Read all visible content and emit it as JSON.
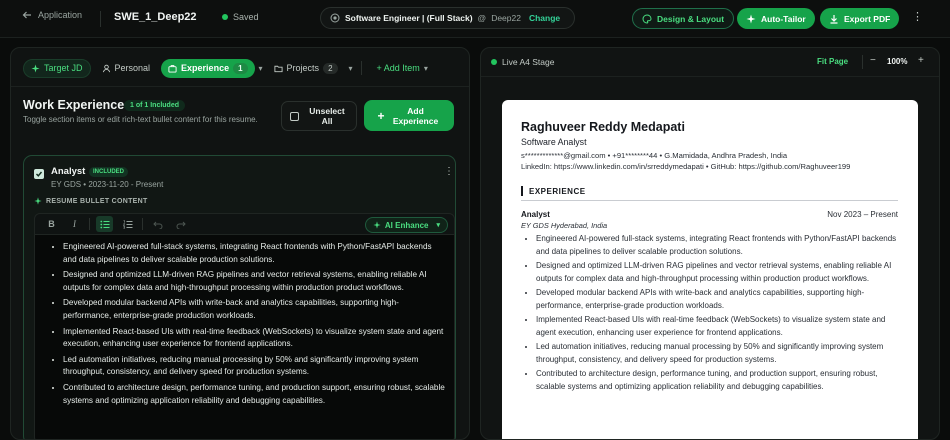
{
  "topbar": {
    "back_label": "Application",
    "doc_title": "SWE_1_Deep22",
    "save_status": "Saved",
    "job_role": "Software Engineer | (Full Stack)",
    "job_at": "@",
    "job_company": "Deep22",
    "change_label": "Change",
    "design_label": "Design & Layout",
    "autotailor_label": "Auto-Tailor",
    "export_label": "Export PDF",
    "more_label": "⋮"
  },
  "editor": {
    "tabs": {
      "target": "Target JD",
      "personal": "Personal",
      "experience": "Experience",
      "experience_count": "1",
      "projects": "Projects",
      "projects_count": "2",
      "add_item": "+ Add Item"
    },
    "section_title": "Work Experience",
    "included_badge": "1 of 1 Included",
    "section_desc": "Toggle section items or edit rich-text bullet content for this resume.",
    "unselect_label": "Unselect All",
    "add_experience_label": "Add Experience",
    "card": {
      "role": "Analyst",
      "included": "INCLUDED",
      "meta": "EY GDS • 2023-11-20 - Present",
      "bullet_content_label": "RESUME BULLET CONTENT",
      "toolbar": {
        "bold": "B",
        "italic": "I",
        "ai_enhance": "AI Enhance"
      },
      "bullets": [
        "Engineered AI-powered full-stack systems, integrating React frontends with Python/FastAPI backends and data pipelines to deliver scalable production solutions.",
        "Designed and optimized LLM-driven RAG pipelines and vector retrieval systems, enabling reliable AI outputs for complex data and high-throughput processing within production product workflows.",
        "Developed modular backend APIs with write-back and analytics capabilities, supporting high-performance, enterprise-grade production workloads.",
        "Implemented React-based UIs with real-time feedback (WebSockets) to visualize system state and agent execution, enhancing user experience for frontend applications.",
        "Led automation initiatives, reducing manual processing by 50% and significantly improving system throughput, consistency, and delivery speed for production systems.",
        "Contributed to architecture design, performance tuning, and production support, ensuring robust, scalable systems and optimizing application reliability and debugging capabilities."
      ]
    }
  },
  "preview": {
    "stage_label": "Live A4 Stage",
    "fit_page": "Fit Page",
    "zoom_out": "−",
    "zoom": "100%",
    "zoom_in": "+",
    "resume": {
      "name": "Raghuveer Reddy Medapati",
      "title": "Software Analyst",
      "contact_line1": "s*************@gmail.com • +91********44 • G.Mamidada, Andhra Pradesh, India",
      "contact_line2": "LinkedIn: https://www.linkedin.com/in/srreddymedapati • GitHub: https://github.com/Raghuveer199",
      "section": "EXPERIENCE",
      "job_role": "Analyst",
      "job_dates": "Nov 2023 – Present",
      "job_company": "EY GDS Hyderabad, India",
      "bullets": [
        "Engineered AI-powered full-stack systems, integrating React frontends with Python/FastAPI backends and data pipelines to deliver scalable production solutions.",
        "Designed and optimized LLM-driven RAG pipelines and vector retrieval systems, enabling reliable AI outputs for complex data and high-throughput processing within production product workflows.",
        "Developed modular backend APIs with write-back and analytics capabilities, supporting high-performance, enterprise-grade production workloads.",
        "Implemented React-based UIs with real-time feedback (WebSockets) to visualize system state and agent execution, enhancing user experience for frontend applications.",
        "Led automation initiatives, reducing manual processing by 50% and significantly improving system throughput, consistency, and delivery speed for production systems.",
        "Contributed to architecture design, performance tuning, and production support, ensuring robust, scalable systems and optimizing application reliability and debugging capabilities."
      ]
    }
  },
  "colors": {
    "accent": "#16a34a",
    "accent_text": "#4ade80",
    "background": "#0a0c0b"
  }
}
